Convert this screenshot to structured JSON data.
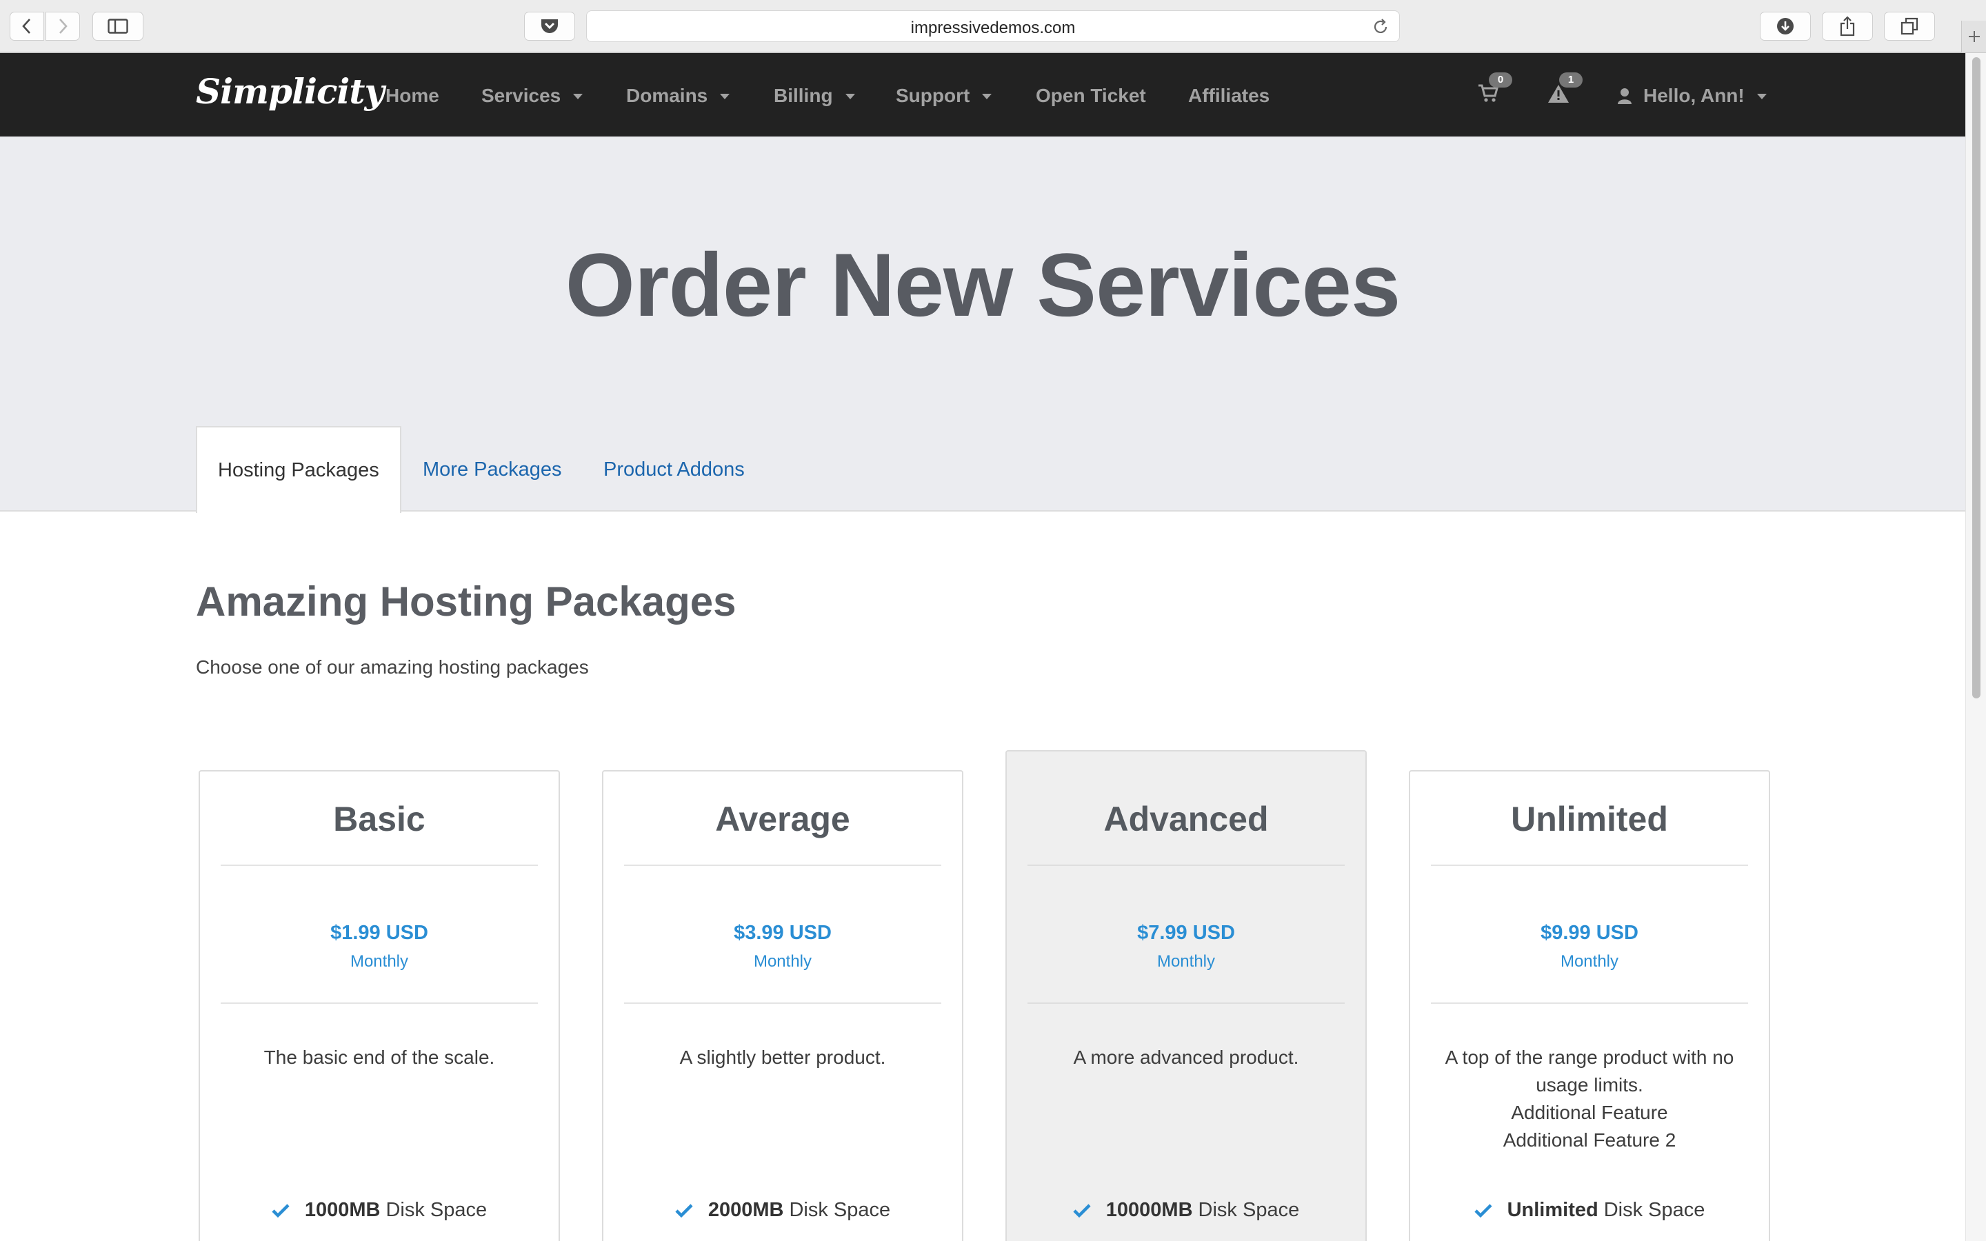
{
  "browser": {
    "url": "impressivedemos.com"
  },
  "navbar": {
    "brand": "Simplicity",
    "items": [
      {
        "label": "Home"
      },
      {
        "label": "Services"
      },
      {
        "label": "Domains"
      },
      {
        "label": "Billing"
      },
      {
        "label": "Support"
      },
      {
        "label": "Open Ticket"
      },
      {
        "label": "Affiliates"
      }
    ],
    "cart_count": "0",
    "alert_count": "1",
    "user_label": "Hello, Ann!"
  },
  "hero": {
    "title": "Order New Services",
    "tabs": [
      {
        "label": "Hosting Packages"
      },
      {
        "label": "More Packages"
      },
      {
        "label": "Product Addons"
      }
    ]
  },
  "section": {
    "title": "Amazing Hosting Packages",
    "subtitle": "Choose one of our amazing hosting packages"
  },
  "packages": [
    {
      "name": "Basic",
      "price": "$1.99 USD",
      "cycle": "Monthly",
      "description": [
        "The basic end of the scale."
      ],
      "feature_value": "1000MB",
      "feature_label": "Disk Space"
    },
    {
      "name": "Average",
      "price": "$3.99 USD",
      "cycle": "Monthly",
      "description": [
        "A slightly better product."
      ],
      "feature_value": "2000MB",
      "feature_label": "Disk Space"
    },
    {
      "name": "Advanced",
      "price": "$7.99 USD",
      "cycle": "Monthly",
      "description": [
        "A more advanced product."
      ],
      "feature_value": "10000MB",
      "feature_label": "Disk Space"
    },
    {
      "name": "Unlimited",
      "price": "$9.99 USD",
      "cycle": "Monthly",
      "description": [
        "A top of the range product with no",
        "usage limits.",
        "Additional Feature",
        "Additional Feature 2"
      ],
      "feature_value": "Unlimited",
      "feature_label": "Disk Space"
    }
  ],
  "colors": {
    "navbar_bg": "#222222",
    "hero_bg": "#ebecf0",
    "link": "#1c66ad",
    "price": "#2a8ed4"
  }
}
